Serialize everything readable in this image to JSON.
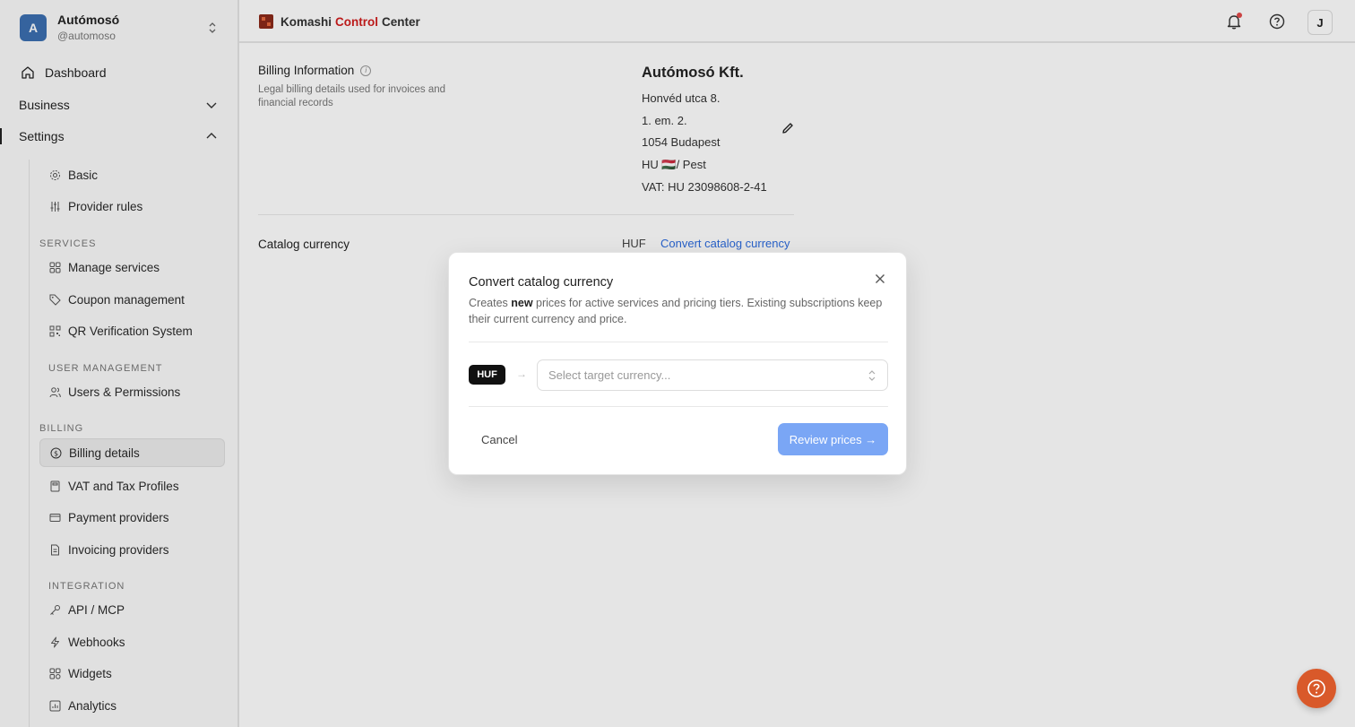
{
  "org": {
    "name": "Autómosó",
    "handle": "@automoso",
    "avatar_letter": "A"
  },
  "nav": {
    "dashboard": "Dashboard",
    "business": "Business",
    "settings": "Settings",
    "settings_items": {
      "basic": "Basic",
      "provider_rules": "Provider rules"
    },
    "services_label": "SERVICES",
    "services_items": {
      "manage": "Manage services",
      "coupons": "Coupon management",
      "qr": "QR Verification System"
    },
    "user_mgmt_label": "USER MANAGEMENT",
    "user_mgmt_items": {
      "users": "Users & Permissions"
    },
    "billing_label": "BILLING",
    "billing_items": {
      "billing_details": "Billing details",
      "vat": "VAT and Tax Profiles",
      "payment": "Payment providers",
      "invoicing": "Invoicing providers"
    },
    "integration_label": "INTEGRATION",
    "integration_items": {
      "api": "API / MCP",
      "webhooks": "Webhooks",
      "widgets": "Widgets",
      "analytics": "Analytics"
    }
  },
  "header": {
    "brand_part1": "Komashi",
    "brand_part2": "Control",
    "brand_part3": "Center",
    "user_initial": "J"
  },
  "billing": {
    "title": "Billing Information",
    "description": "Legal billing details used for invoices and financial records",
    "company": "Autómosó Kft.",
    "address1": "Honvéd utca 8.",
    "address2": "1. em. 2.",
    "address3": "1054 Budapest",
    "country_line": "HU 🇭🇺/ Pest",
    "vat_line": "VAT: HU 23098608-2-41"
  },
  "catalog": {
    "label": "Catalog currency",
    "value": "HUF",
    "link": "Convert catalog currency"
  },
  "modal": {
    "title": "Convert catalog currency",
    "desc_pre": "Creates ",
    "desc_bold": "new",
    "desc_post": " prices for active services and pricing tiers. Existing subscriptions keep their current currency and price.",
    "source_currency": "HUF",
    "arrow": "→",
    "select_placeholder": "Select target currency...",
    "cancel": "Cancel",
    "review": "Review prices →"
  },
  "colors": {
    "brand_red": "#d11e1e",
    "link_blue": "#2d6cdf",
    "primary_button": "#7aa6f5",
    "help_fab": "#d9592a"
  }
}
